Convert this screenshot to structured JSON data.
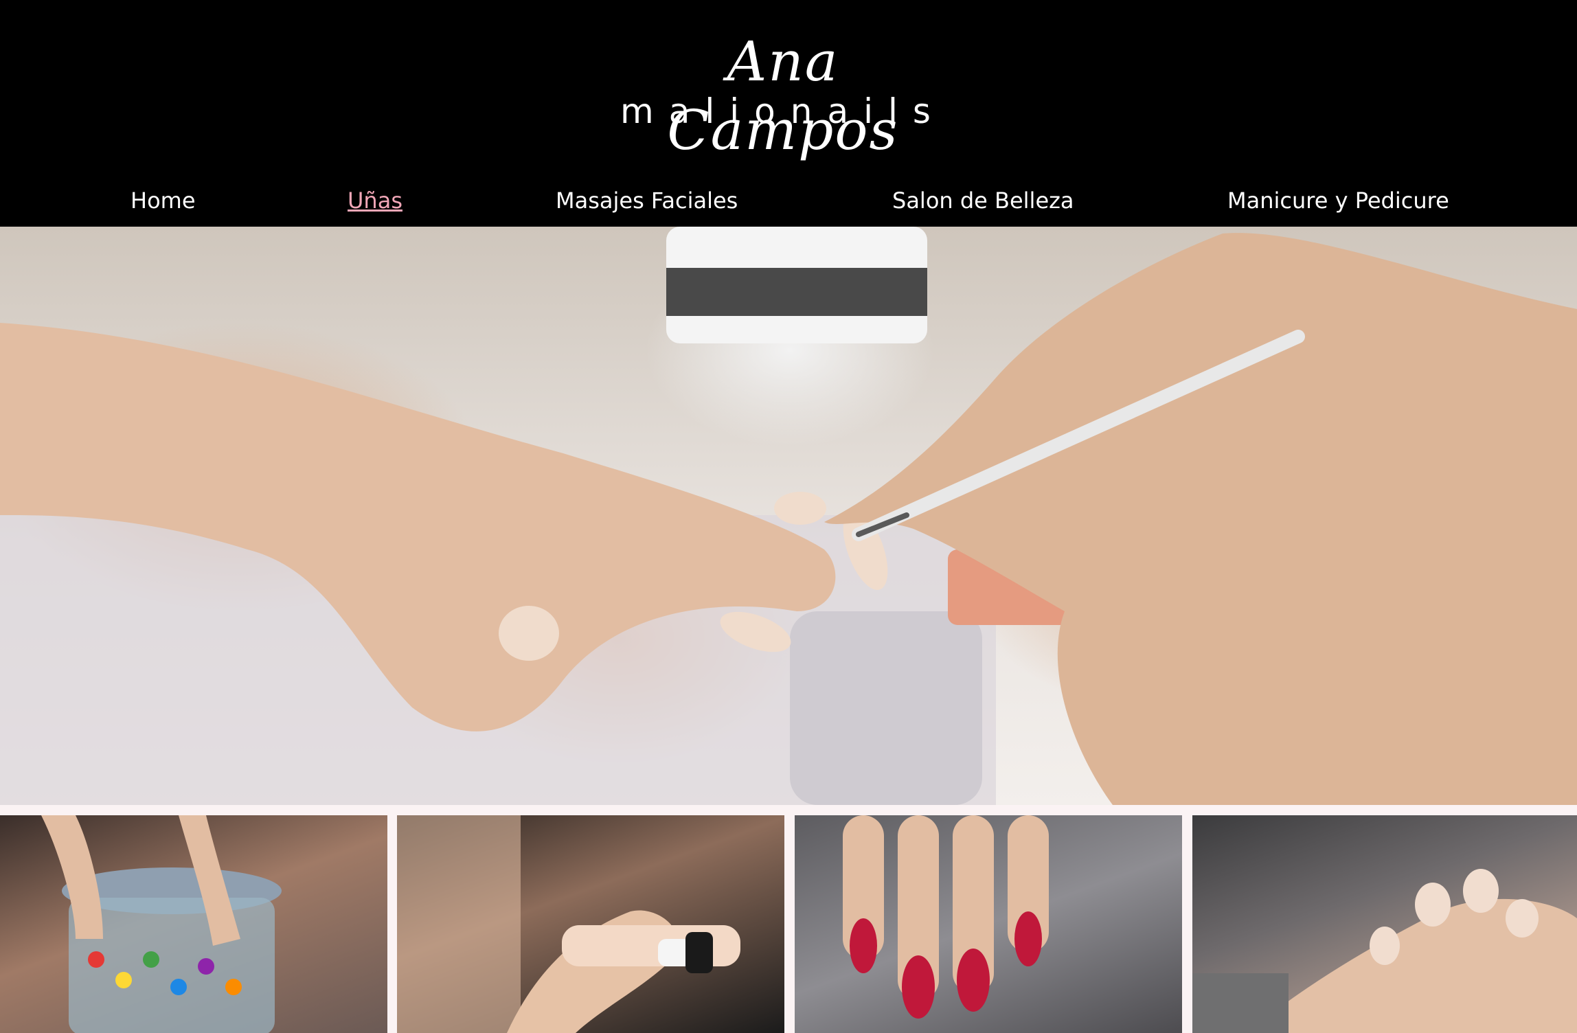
{
  "logo": {
    "script_text": "Ana Campos",
    "brand_text": "malionails"
  },
  "nav": {
    "items": [
      {
        "label": "Home",
        "active": false
      },
      {
        "label": "Uñas",
        "active": true
      },
      {
        "label": "Masajes Faciales",
        "active": false
      },
      {
        "label": "Salon de Belleza",
        "active": false
      },
      {
        "label": "Manicure y Pedicure",
        "active": false
      }
    ]
  },
  "colors": {
    "header_bg": "#000000",
    "nav_text": "#ffffff",
    "nav_active": "#f2a7b8",
    "page_bg": "#fbf3f4"
  },
  "images": {
    "hero": "manicure-in-progress-photo",
    "thumbnails": [
      "hands-on-bead-jar-photo",
      "painting-nails-photo",
      "red-love-nails-photo",
      "nude-nails-photo"
    ]
  }
}
